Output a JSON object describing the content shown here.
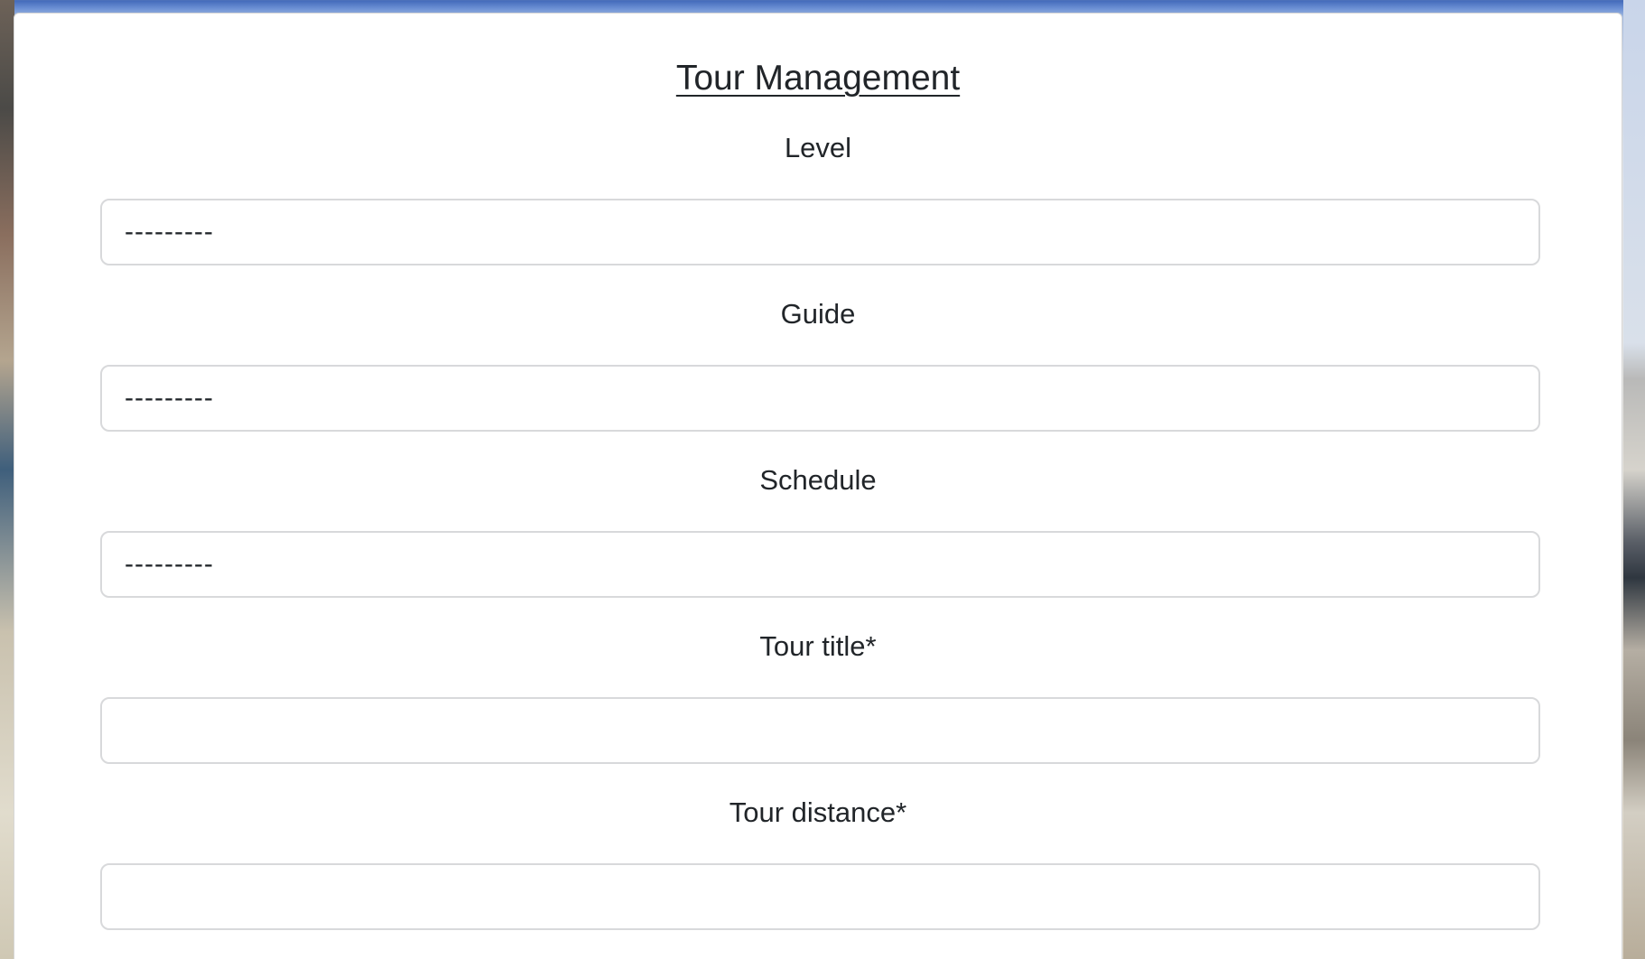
{
  "form": {
    "title": "Tour Management",
    "fields": [
      {
        "label": "Level",
        "type": "select",
        "value": "---------"
      },
      {
        "label": "Guide",
        "type": "select",
        "value": "---------"
      },
      {
        "label": "Schedule",
        "type": "select",
        "value": "---------"
      },
      {
        "label": "Tour title*",
        "type": "text",
        "value": ""
      },
      {
        "label": "Tour distance*",
        "type": "text",
        "value": ""
      }
    ]
  }
}
